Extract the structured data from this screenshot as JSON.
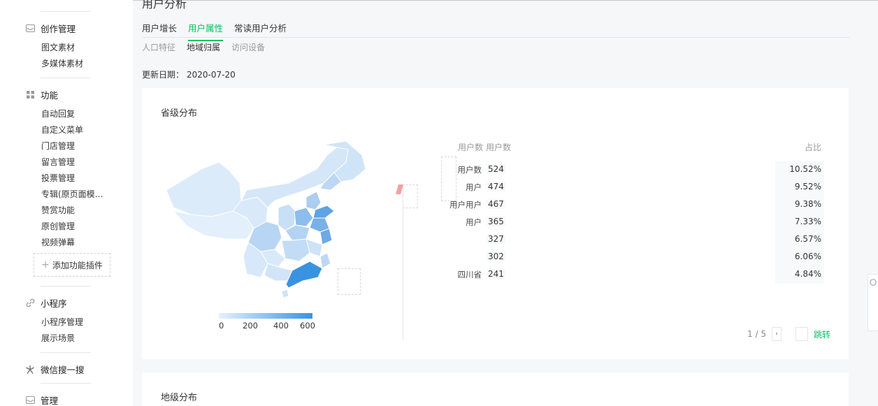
{
  "sidebar": {
    "sections": [
      {
        "icon": "inbox-icon",
        "label": "创作管理",
        "items": [
          "图文素材",
          "多媒体素材"
        ]
      },
      {
        "icon": "grid-icon",
        "label": "功能",
        "items": [
          "自动回复",
          "自定义菜单",
          "门店管理",
          "留言管理",
          "投票管理",
          "专辑(原页面模…",
          "赞赏功能",
          "原创管理",
          "视频弹幕"
        ]
      },
      {
        "icon": "link-icon",
        "label": "小程序",
        "items": [
          "小程序管理",
          "展示场景"
        ]
      },
      {
        "icon": "sparkle-icon",
        "label": "微信搜一搜",
        "items": []
      },
      {
        "icon": "inbox-icon",
        "label": "管理",
        "items": []
      }
    ],
    "add_plugin": "添加功能插件"
  },
  "page": {
    "title": "用户分析",
    "tabs": [
      "用户增长",
      "用户属性",
      "常读用户分析"
    ],
    "active_tab": "用户属性",
    "subtabs": [
      "人口特征",
      "地域归属",
      "访问设备"
    ],
    "active_subtab": "地域归属",
    "update_label": "更新日期：",
    "update_value": "2020-07-20"
  },
  "province": {
    "title": "省级分布",
    "legend": [
      "0",
      "200",
      "400",
      "600"
    ],
    "table_headers": {
      "c1": "用户数",
      "c2": "用户数",
      "c3": "占比"
    },
    "rows": [
      {
        "name": "用户数",
        "value": "524",
        "pct": "10.52%"
      },
      {
        "name": "用户",
        "value": "474",
        "pct": "9.52%"
      },
      {
        "name": "用户用户",
        "value": "467",
        "pct": "9.38%"
      },
      {
        "name": "用户",
        "value": "365",
        "pct": "7.33%"
      },
      {
        "name": "",
        "value": "327",
        "pct": "6.57%"
      },
      {
        "name": "",
        "value": "302",
        "pct": "6.06%"
      },
      {
        "name": "四川省",
        "value": "241",
        "pct": "4.84%"
      }
    ],
    "pager": {
      "text": "1 / 5",
      "next": "›",
      "jump": "跳转"
    }
  },
  "city": {
    "title": "地级分布"
  },
  "colors": {
    "accent": "#07c160",
    "map_high": "#3a93e0",
    "map_low": "#e6f1fc"
  }
}
